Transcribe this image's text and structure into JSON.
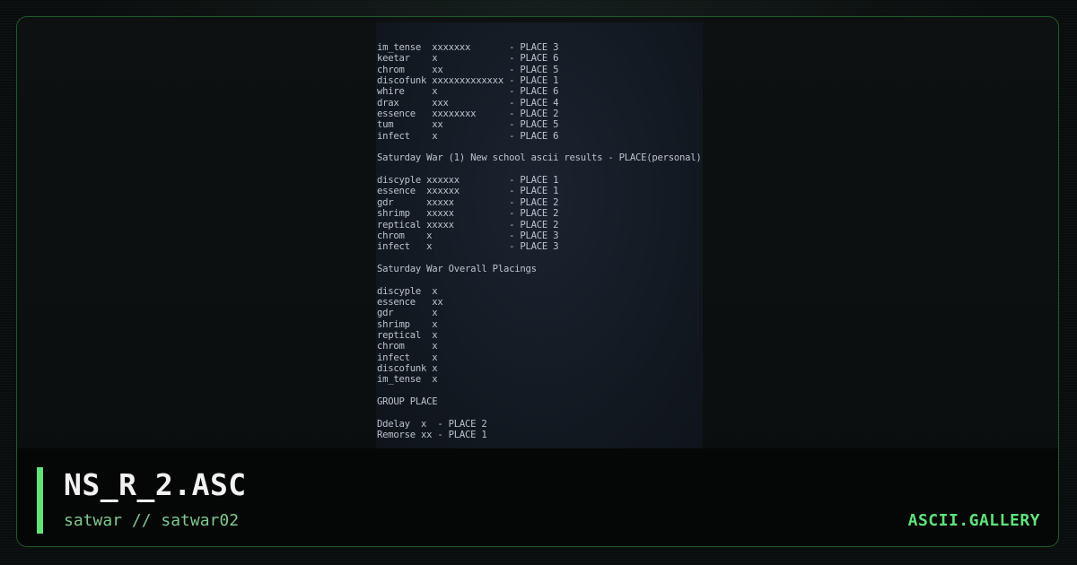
{
  "art": {
    "text": "im_tense  xxxxxxx       - PLACE 3\nkeetar    x             - PLACE 6\nchrom     xx            - PLACE 5\ndiscofunk xxxxxxxxxxxxx - PLACE 1\nwhire     x             - PLACE 6\ndrax      xxx           - PLACE 4\nessence   xxxxxxxx      - PLACE 2\ntum       xx            - PLACE 5\ninfect    x             - PLACE 6\n\nSaturday War (1) New school ascii results - PLACE(personal)\n\ndiscyple xxxxxx         - PLACE 1\nessence  xxxxxx         - PLACE 1\ngdr      xxxxx          - PLACE 2\nshrimp   xxxxx          - PLACE 2\nreptical xxxxx          - PLACE 2\nchrom    x              - PLACE 3\ninfect   x              - PLACE 3\n\nSaturday War Overall Placings\n\ndiscyple  x\nessence   xx\ngdr       x\nshrimp    x\nreptical  x\nchrom     x\ninfect    x\ndiscofunk x\nim_tense  x\n\nGROUP PLACE\n\nDdelay  x  - PLACE 2\nRemorse xx - PLACE 1"
  },
  "footer": {
    "title": "NS_R_2.ASC",
    "subtitle": "satwar // satwar02",
    "brand": "ASCII.GALLERY"
  },
  "colors": {
    "accent": "#5fe37a",
    "frame_border": "#1f5a2c",
    "subtitle": "#7fc98e",
    "title": "#f2f2f2",
    "art_background": "#161d27"
  }
}
